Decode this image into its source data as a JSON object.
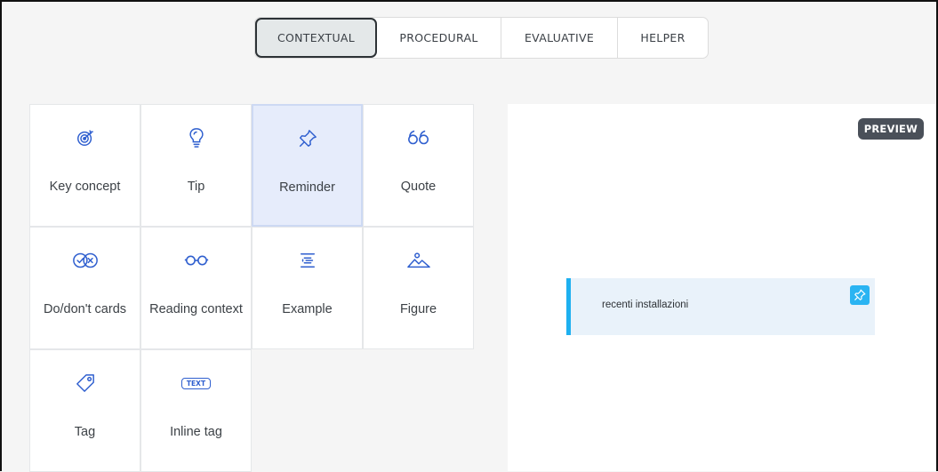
{
  "tabs": [
    {
      "label": "CONTEXTUAL",
      "active": true
    },
    {
      "label": "PROCEDURAL",
      "active": false
    },
    {
      "label": "EVALUATIVE",
      "active": false
    },
    {
      "label": "HELPER",
      "active": false
    }
  ],
  "blocks": [
    {
      "label": "Key concept",
      "icon": "target-icon"
    },
    {
      "label": "Tip",
      "icon": "lightbulb-icon"
    },
    {
      "label": "Reminder",
      "icon": "pin-icon",
      "selected": true
    },
    {
      "label": "Quote",
      "icon": "quote-icon"
    },
    {
      "label": "Do/don't cards",
      "icon": "check-cross-icon"
    },
    {
      "label": "Reading context",
      "icon": "glasses-icon"
    },
    {
      "label": "Example",
      "icon": "list-icon"
    },
    {
      "label": "Figure",
      "icon": "mountain-image-icon"
    },
    {
      "label": "Tag",
      "icon": "tag-icon"
    },
    {
      "label": "Inline tag",
      "icon": "text-tag-icon",
      "icon_text": "TEXT"
    }
  ],
  "preview": {
    "badge": "PREVIEW",
    "reminder_text": "recenti installazioni"
  },
  "colors": {
    "icon": "#2f5fcf",
    "accent": "#1eb0f0",
    "selected_bg": "#e6ecfb",
    "badge_bg": "#4a5059"
  }
}
